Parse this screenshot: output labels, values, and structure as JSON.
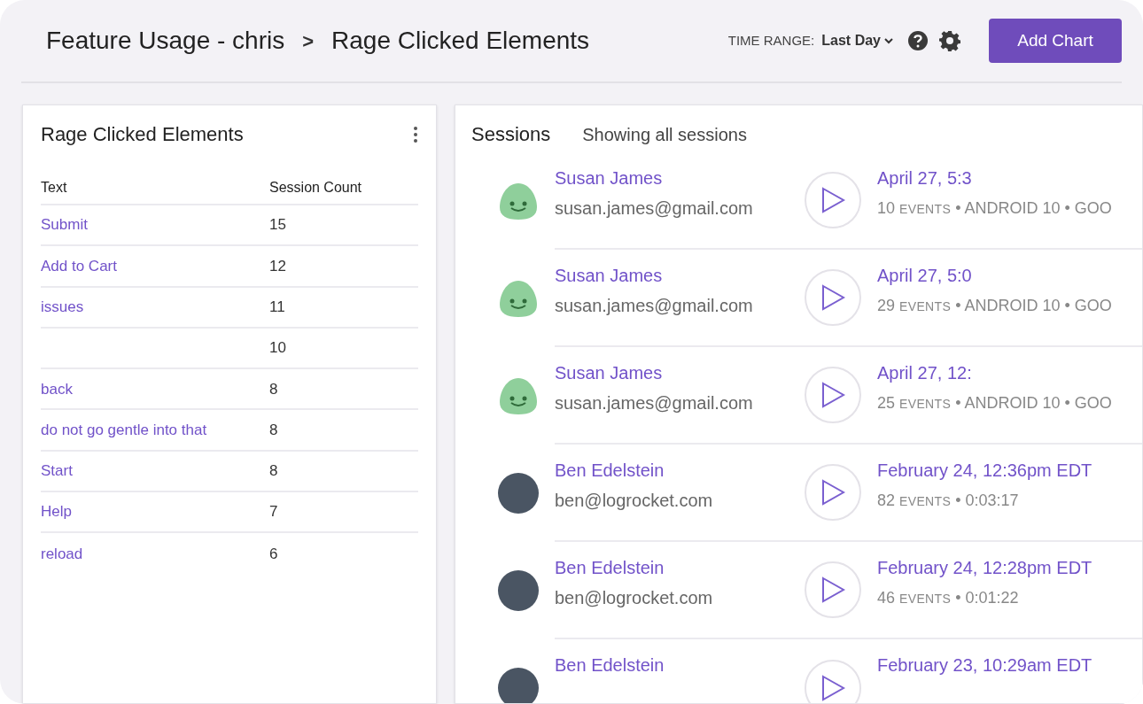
{
  "header": {
    "breadcrumb": [
      "Feature Usage - chris",
      "Rage Clicked Elements"
    ],
    "separator": ">",
    "time_range_label": "TIME RANGE:",
    "time_range_value": "Last Day",
    "add_button": "Add Chart"
  },
  "elements_panel": {
    "title": "Rage Clicked Elements",
    "columns": [
      "Text",
      "Session Count"
    ],
    "rows": [
      {
        "text": "Submit",
        "count": "15"
      },
      {
        "text": "Add to Cart",
        "count": "12"
      },
      {
        "text": "issues",
        "count": "11"
      },
      {
        "text": "",
        "count": "10"
      },
      {
        "text": "back",
        "count": "8"
      },
      {
        "text": "do not go gentle into that",
        "count": "8"
      },
      {
        "text": "Start",
        "count": "8"
      },
      {
        "text": "Help",
        "count": "7"
      },
      {
        "text": "reload",
        "count": "6"
      }
    ]
  },
  "sessions_panel": {
    "title": "Sessions",
    "subtitle": "Showing all sessions",
    "sessions": [
      {
        "kind": "icon",
        "name": "Susan James",
        "email": "susan.james@gmail.com",
        "date": "April 27, 5:3",
        "event_count": "10",
        "event_unit": "EVENTS",
        "rest": "• ANDROID 10 • GOO"
      },
      {
        "kind": "icon",
        "name": "Susan James",
        "email": "susan.james@gmail.com",
        "date": "April 27, 5:0",
        "event_count": "29",
        "event_unit": "EVENTS",
        "rest": "• ANDROID 10 • GOO"
      },
      {
        "kind": "icon",
        "name": "Susan James",
        "email": "susan.james@gmail.com",
        "date": "April 27, 12:",
        "event_count": "25",
        "event_unit": "EVENTS",
        "rest": "• ANDROID 10 • GOO"
      },
      {
        "kind": "photo",
        "name": "Ben Edelstein",
        "email": "ben@logrocket.com",
        "date": "February 24, 12:36pm EDT",
        "event_count": "82",
        "event_unit": "EVENTS",
        "rest": "• 0:03:17"
      },
      {
        "kind": "photo",
        "name": "Ben Edelstein",
        "email": "ben@logrocket.com",
        "date": "February 24, 12:28pm EDT",
        "event_count": "46",
        "event_unit": "EVENTS",
        "rest": "• 0:01:22"
      },
      {
        "kind": "photo",
        "name": "Ben Edelstein",
        "date": "February 23, 10:29am EDT"
      }
    ]
  }
}
